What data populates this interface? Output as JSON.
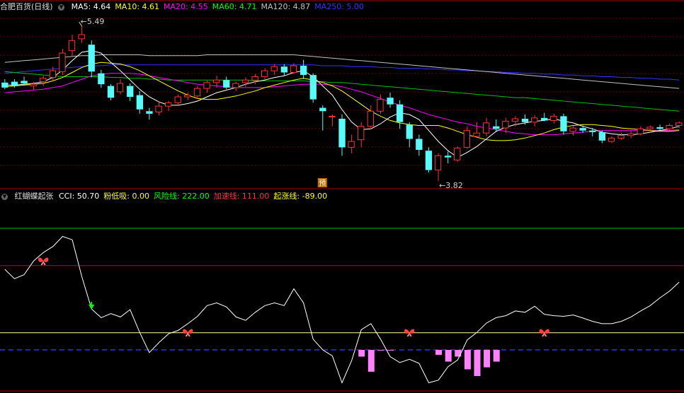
{
  "main_panel": {
    "title": "合肥百货(日线)",
    "indicators": [
      {
        "label": "MA5: 4.64",
        "color": "#ffffff"
      },
      {
        "label": "MA10: 4.61",
        "color": "#ffff00"
      },
      {
        "label": "MA20: 4.55",
        "color": "#ff00ff"
      },
      {
        "label": "MA60: 4.71",
        "color": "#00ff00"
      },
      {
        "label": "MA120: 4.87",
        "color": "#c0c0c0"
      },
      {
        "label": "MA250: 5.00",
        "color": "#3333ff"
      }
    ],
    "high_label": "5.49",
    "low_label": "3.82",
    "forecast_badge": "预"
  },
  "sub_panel": {
    "title": "红蝴蝶起张",
    "indicators": [
      {
        "label": "CCI: 50.70",
        "color": "#ffffff"
      },
      {
        "label": "粉低吸: 0.00",
        "color": "#ffff00"
      },
      {
        "label": "风险线: 222.00",
        "color": "#00ff00"
      },
      {
        "label": "加速线: 111.00",
        "color": "#ff3333"
      },
      {
        "label": "起涨线: -89.00",
        "color": "#ffff00"
      }
    ]
  },
  "chart_data": [
    {
      "type": "candlestick",
      "ylim": [
        3.6,
        5.65
      ],
      "colors": {
        "up": "#ff3232",
        "down": "#54fcfc",
        "ma_short": "#ffffff",
        "ma10": "#ffff00",
        "ma20": "#ff00ff",
        "ma60": "#00c000",
        "ma120": "#c0c0c0",
        "ma250": "#3333ff"
      },
      "candles": [
        [
          4.82,
          4.86,
          4.74,
          4.76
        ],
        [
          4.83,
          4.86,
          4.76,
          4.78
        ],
        [
          4.84,
          4.89,
          4.79,
          4.81
        ],
        [
          4.78,
          4.83,
          4.73,
          4.8
        ],
        [
          4.83,
          4.9,
          4.78,
          4.87
        ],
        [
          4.88,
          5.01,
          4.83,
          4.96
        ],
        [
          4.95,
          5.22,
          4.91,
          5.17
        ],
        [
          5.2,
          5.39,
          5.13,
          5.32
        ],
        [
          5.34,
          5.49,
          5.29,
          5.39
        ],
        [
          5.27,
          5.32,
          4.88,
          4.95
        ],
        [
          4.93,
          4.97,
          4.76,
          4.8
        ],
        [
          4.78,
          4.8,
          4.61,
          4.64
        ],
        [
          4.71,
          4.86,
          4.68,
          4.81
        ],
        [
          4.78,
          4.81,
          4.6,
          4.65
        ],
        [
          4.67,
          4.72,
          4.45,
          4.5
        ],
        [
          4.48,
          4.52,
          4.38,
          4.45
        ],
        [
          4.47,
          4.59,
          4.43,
          4.54
        ],
        [
          4.54,
          4.6,
          4.48,
          4.58
        ],
        [
          4.58,
          4.68,
          4.54,
          4.65
        ],
        [
          4.65,
          4.7,
          4.61,
          4.67
        ],
        [
          4.66,
          4.78,
          4.63,
          4.75
        ],
        [
          4.75,
          4.84,
          4.7,
          4.82
        ],
        [
          4.82,
          4.9,
          4.76,
          4.85
        ],
        [
          4.85,
          4.89,
          4.74,
          4.76
        ],
        [
          4.76,
          4.83,
          4.72,
          4.81
        ],
        [
          4.82,
          4.88,
          4.77,
          4.85
        ],
        [
          4.85,
          4.92,
          4.8,
          4.89
        ],
        [
          4.89,
          4.99,
          4.85,
          4.96
        ],
        [
          4.96,
          5.04,
          4.91,
          5.01
        ],
        [
          5.01,
          5.04,
          4.9,
          4.94
        ],
        [
          4.94,
          5.05,
          4.92,
          5.02
        ],
        [
          5.02,
          5.09,
          4.86,
          4.91
        ],
        [
          4.91,
          4.93,
          4.58,
          4.62
        ],
        [
          4.52,
          4.55,
          4.25,
          4.48
        ],
        [
          4.42,
          4.44,
          4.3,
          4.42
        ],
        [
          4.39,
          4.44,
          3.95,
          4.05
        ],
        [
          4.05,
          4.2,
          3.98,
          4.12
        ],
        [
          4.14,
          4.35,
          4.05,
          4.3
        ],
        [
          4.3,
          4.55,
          4.26,
          4.48
        ],
        [
          4.48,
          4.68,
          4.45,
          4.62
        ],
        [
          4.64,
          4.7,
          4.52,
          4.56
        ],
        [
          4.56,
          4.61,
          4.27,
          4.35
        ],
        [
          4.32,
          4.35,
          4.05,
          4.15
        ],
        [
          4.15,
          4.2,
          3.95,
          4.02
        ],
        [
          4.01,
          4.05,
          3.75,
          3.78
        ],
        [
          3.78,
          3.98,
          3.65,
          3.95
        ],
        [
          3.95,
          4.0,
          3.86,
          3.93
        ],
        [
          3.9,
          4.06,
          3.88,
          4.04
        ],
        [
          4.05,
          4.3,
          4.03,
          4.25
        ],
        [
          4.18,
          4.35,
          4.16,
          4.22
        ],
        [
          4.22,
          4.4,
          4.18,
          4.34
        ],
        [
          4.3,
          4.38,
          4.23,
          4.27
        ],
        [
          4.28,
          4.4,
          4.22,
          4.36
        ],
        [
          4.36,
          4.42,
          4.3,
          4.39
        ],
        [
          4.39,
          4.44,
          4.32,
          4.35
        ],
        [
          4.35,
          4.43,
          4.3,
          4.4
        ],
        [
          4.4,
          4.46,
          4.36,
          4.37
        ],
        [
          4.37,
          4.45,
          4.33,
          4.42
        ],
        [
          4.42,
          4.45,
          4.2,
          4.24
        ],
        [
          4.24,
          4.3,
          4.19,
          4.28
        ],
        [
          4.28,
          4.31,
          4.22,
          4.25
        ],
        [
          4.25,
          4.28,
          4.18,
          4.23
        ],
        [
          4.23,
          4.25,
          4.1,
          4.13
        ],
        [
          4.12,
          4.18,
          4.1,
          4.16
        ],
        [
          4.16,
          4.22,
          4.14,
          4.19
        ],
        [
          4.19,
          4.25,
          4.16,
          4.21
        ],
        [
          4.21,
          4.3,
          4.19,
          4.27
        ],
        [
          4.27,
          4.31,
          4.23,
          4.29
        ],
        [
          4.29,
          4.32,
          4.25,
          4.27
        ],
        [
          4.27,
          4.33,
          4.25,
          4.31
        ],
        [
          4.31,
          4.36,
          4.28,
          4.34
        ]
      ],
      "ma_short": [
        4.79,
        4.79,
        4.8,
        4.81,
        4.83,
        4.88,
        4.97,
        5.08,
        5.18,
        5.2,
        5.17,
        5.06,
        4.96,
        4.85,
        4.74,
        4.65,
        4.59,
        4.55,
        4.55,
        4.57,
        4.6,
        4.65,
        4.7,
        4.73,
        4.76,
        4.8,
        4.83,
        4.85,
        4.88,
        4.9,
        4.94,
        4.96,
        4.89,
        4.78,
        4.67,
        4.5,
        4.35,
        4.26,
        4.27,
        4.33,
        4.41,
        4.46,
        4.44,
        4.38,
        4.25,
        4.12,
        4.01,
        3.93,
        3.99,
        4.06,
        4.15,
        4.24,
        4.29,
        4.32,
        4.34,
        4.36,
        4.37,
        4.39,
        4.36,
        4.34,
        4.3,
        4.27,
        4.23,
        4.21,
        4.2,
        4.2,
        4.21,
        4.23,
        4.25,
        4.27,
        4.3
      ],
      "ma10": [
        4.77,
        4.78,
        4.79,
        4.8,
        4.81,
        4.84,
        4.88,
        4.94,
        5.0,
        5.04,
        5.06,
        5.05,
        5.04,
        5.01,
        4.96,
        4.9,
        4.84,
        4.78,
        4.72,
        4.67,
        4.63,
        4.62,
        4.62,
        4.64,
        4.66,
        4.69,
        4.72,
        4.76,
        4.79,
        4.82,
        4.85,
        4.87,
        4.85,
        4.82,
        4.78,
        4.72,
        4.64,
        4.56,
        4.48,
        4.42,
        4.37,
        4.34,
        4.32,
        4.31,
        4.31,
        4.31,
        4.28,
        4.24,
        4.2,
        4.17,
        4.14,
        4.13,
        4.13,
        4.14,
        4.16,
        4.19,
        4.22,
        4.26,
        4.29,
        4.31,
        4.32,
        4.32,
        4.31,
        4.3,
        4.28,
        4.27,
        4.26,
        4.25,
        4.24,
        4.24,
        4.25
      ],
      "ma20": [
        4.7,
        4.71,
        4.72,
        4.73,
        4.74,
        4.76,
        4.78,
        4.82,
        4.86,
        4.9,
        4.92,
        4.93,
        4.93,
        4.93,
        4.92,
        4.9,
        4.88,
        4.86,
        4.84,
        4.82,
        4.8,
        4.79,
        4.78,
        4.77,
        4.76,
        4.76,
        4.76,
        4.76,
        4.77,
        4.78,
        4.79,
        4.8,
        4.8,
        4.8,
        4.79,
        4.77,
        4.74,
        4.71,
        4.67,
        4.63,
        4.59,
        4.55,
        4.52,
        4.48,
        4.44,
        4.41,
        4.38,
        4.35,
        4.33,
        4.3,
        4.28,
        4.26,
        4.24,
        4.22,
        4.21,
        4.2,
        4.2,
        4.2,
        4.21,
        4.22,
        4.23,
        4.24,
        4.25,
        4.25,
        4.25,
        4.25,
        4.25,
        4.25,
        4.25,
        4.25,
        4.26
      ],
      "ma60": [
        4.95,
        4.94,
        4.93,
        4.92,
        4.91,
        4.9,
        4.89,
        4.89,
        4.89,
        4.89,
        4.89,
        4.88,
        4.88,
        4.87,
        4.87,
        4.86,
        4.86,
        4.85,
        4.85,
        4.85,
        4.85,
        4.85,
        4.85,
        4.85,
        4.85,
        4.85,
        4.84,
        4.84,
        4.84,
        4.84,
        4.84,
        4.84,
        4.83,
        4.83,
        4.82,
        4.82,
        4.81,
        4.8,
        4.79,
        4.78,
        4.77,
        4.76,
        4.75,
        4.74,
        4.73,
        4.72,
        4.71,
        4.7,
        4.69,
        4.68,
        4.67,
        4.66,
        4.65,
        4.64,
        4.64,
        4.63,
        4.62,
        4.61,
        4.6,
        4.59,
        4.58,
        4.57,
        4.56,
        4.55,
        4.54,
        4.53,
        4.52,
        4.51,
        4.5,
        4.49,
        4.48
      ],
      "ma120": [
        5.06,
        5.07,
        5.08,
        5.09,
        5.1,
        5.11,
        5.12,
        5.13,
        5.14,
        5.14,
        5.15,
        5.15,
        5.15,
        5.15,
        5.15,
        5.14,
        5.14,
        5.14,
        5.14,
        5.14,
        5.14,
        5.15,
        5.15,
        5.15,
        5.15,
        5.15,
        5.15,
        5.15,
        5.15,
        5.15,
        5.15,
        5.14,
        5.13,
        5.12,
        5.11,
        5.1,
        5.09,
        5.08,
        5.07,
        5.06,
        5.05,
        5.04,
        5.03,
        5.02,
        5.01,
        5.0,
        4.99,
        4.98,
        4.97,
        4.96,
        4.95,
        4.94,
        4.93,
        4.92,
        4.91,
        4.9,
        4.89,
        4.88,
        4.87,
        4.86,
        4.85,
        4.84,
        4.83,
        4.82,
        4.81,
        4.8,
        4.79,
        4.78,
        4.77,
        4.76,
        4.75
      ],
      "ma250": [
        4.93,
        4.94,
        4.95,
        4.96,
        4.97,
        4.98,
        4.99,
        5.0,
        5.01,
        5.02,
        5.02,
        5.03,
        5.03,
        5.03,
        5.03,
        5.03,
        5.03,
        5.03,
        5.03,
        5.03,
        5.03,
        5.03,
        5.03,
        5.03,
        5.03,
        5.03,
        5.03,
        5.03,
        5.03,
        5.03,
        5.03,
        5.03,
        5.03,
        5.02,
        5.02,
        5.02,
        5.01,
        5.01,
        5.01,
        5.0,
        5.0,
        4.99,
        4.99,
        4.99,
        4.98,
        4.98,
        4.97,
        4.97,
        4.96,
        4.96,
        4.95,
        4.95,
        4.94,
        4.94,
        4.93,
        4.93,
        4.92,
        4.92,
        4.91,
        4.91,
        4.9,
        4.9,
        4.89,
        4.89,
        4.88,
        4.88,
        4.87,
        4.87,
        4.86,
        4.86,
        4.85
      ],
      "forecast_index": 33
    },
    {
      "type": "line",
      "ylim": [
        -260,
        300
      ],
      "levels": {
        "risk": 222,
        "accel": 111,
        "rise": -89,
        "base": -140
      },
      "cci": [
        100,
        72,
        84,
        125,
        150,
        168,
        198,
        188,
        78,
        -18,
        -44,
        -32,
        -42,
        -20,
        -88,
        -148,
        -118,
        -92,
        -82,
        -62,
        -40,
        -8,
        0,
        -12,
        -42,
        -52,
        -28,
        -8,
        0,
        -8,
        42,
        0,
        -108,
        -140,
        -158,
        -238,
        -172,
        -80,
        -62,
        -108,
        -160,
        -178,
        -168,
        -180,
        -238,
        -230,
        -190,
        -170,
        -110,
        -88,
        -60,
        -44,
        -38,
        -24,
        -28,
        -10,
        -34,
        -38,
        -40,
        -36,
        -45,
        -55,
        -62,
        -62,
        -55,
        -42,
        -24,
        -8,
        15,
        35,
        62
      ],
      "pink_bars": [
        [
          37,
          -160
        ],
        [
          38,
          -205
        ],
        [
          39,
          -132
        ],
        [
          40,
          -132
        ],
        [
          45,
          -155
        ],
        [
          46,
          -175
        ],
        [
          47,
          -160
        ],
        [
          48,
          -198
        ],
        [
          49,
          -218
        ],
        [
          50,
          -192
        ],
        [
          51,
          -175
        ]
      ],
      "butterflies": [
        [
          4,
          125
        ],
        [
          19,
          -88
        ],
        [
          42,
          -88
        ],
        [
          56,
          -88
        ]
      ],
      "down_arrow_index": 9
    }
  ]
}
